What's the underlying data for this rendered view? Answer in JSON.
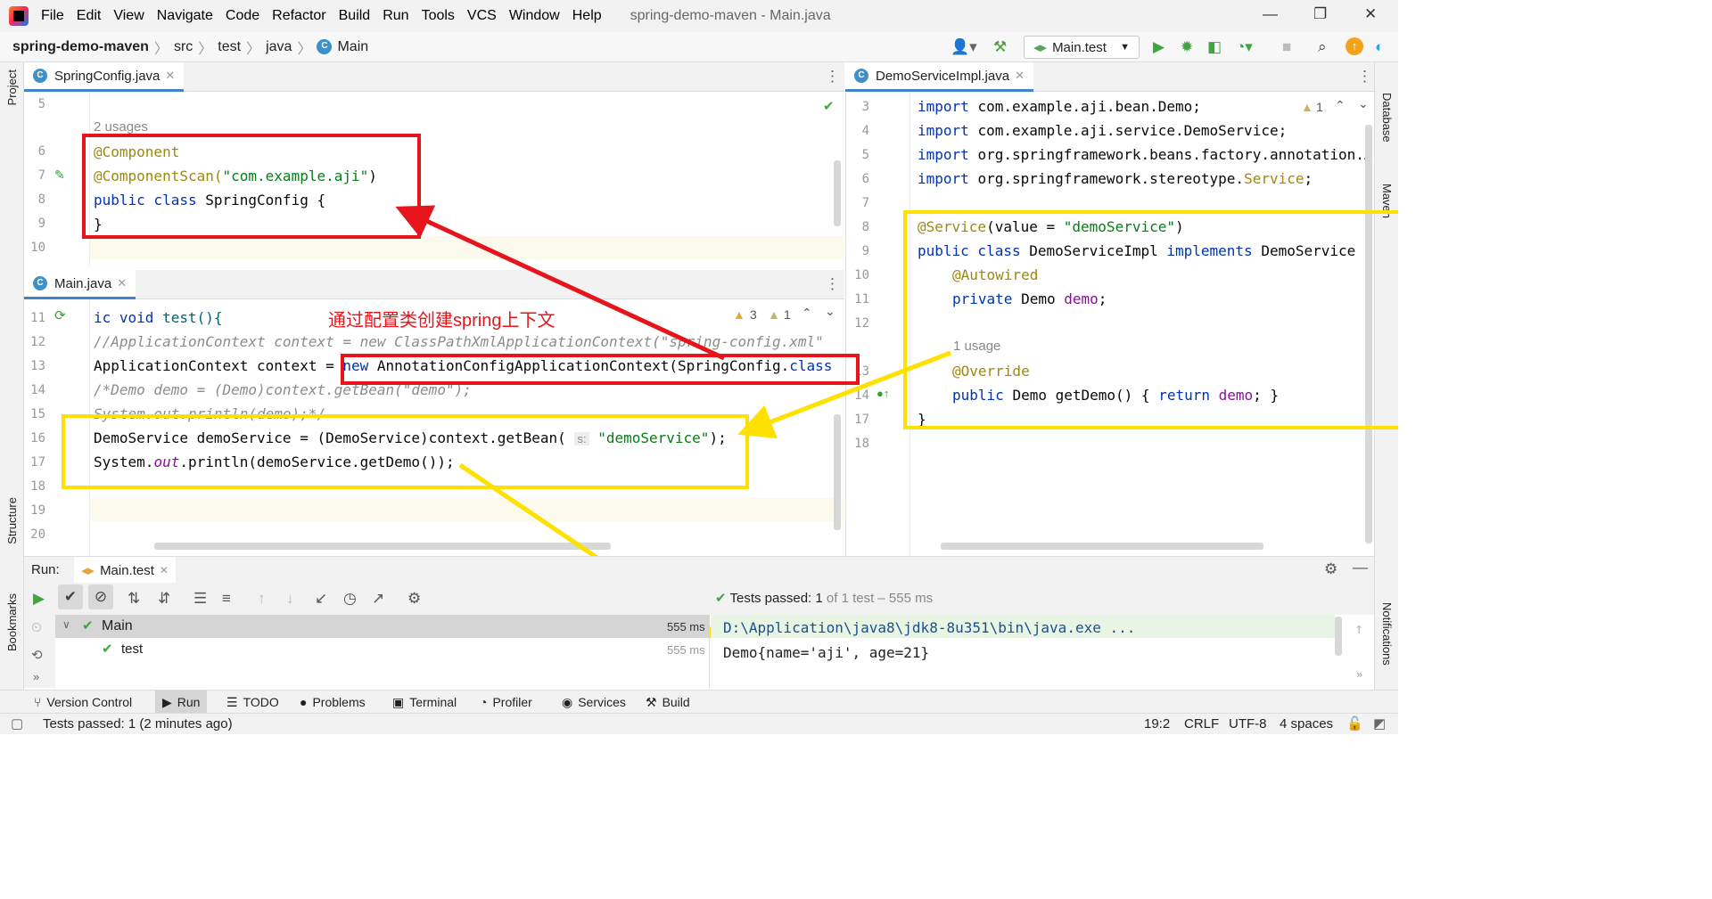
{
  "menubar": {
    "items": [
      "File",
      "Edit",
      "View",
      "Navigate",
      "Code",
      "Refactor",
      "Build",
      "Run",
      "Tools",
      "VCS",
      "Window",
      "Help"
    ],
    "window_title": "spring-demo-maven - Main.java"
  },
  "navbar": {
    "project": "spring-demo-maven",
    "crumbs": [
      "src",
      "test",
      "java"
    ],
    "file": "Main"
  },
  "toolbar": {
    "run_config": "Main.test"
  },
  "left_strip": {
    "project": "Project",
    "structure": "Structure",
    "bookmarks": "Bookmarks"
  },
  "right_strip": {
    "database": "Database",
    "maven": "Maven",
    "notifications": "Notifications"
  },
  "editor_top_left": {
    "tab": "SpringConfig.java",
    "usages": "2 usages",
    "line_numbers": [
      "5",
      "6",
      "7",
      "8",
      "9",
      "10"
    ],
    "lines": {
      "l6": "@Component",
      "l7a": "@ComponentScan(",
      "l7b": "\"com.example.aji\"",
      "l7c": ")",
      "l8a": "public class ",
      "l8b": "SpringConfig {",
      "l9": "}"
    }
  },
  "editor_bottom_left": {
    "tab": "Main.java",
    "inspections": {
      "warnings": "3",
      "weak": "1"
    },
    "line_numbers": [
      "11",
      "12",
      "13",
      "14",
      "15",
      "16",
      "17",
      "18",
      "19",
      "20"
    ],
    "lines": {
      "l11a": "ic void ",
      "l11b": "test(){",
      "l12": "//ApplicationContext context = new ClassPathXmlApplicationContext(\"spring-config.xml\"",
      "l13a": "ApplicationContext context = ",
      "l13b": "new ",
      "l13c": "AnnotationConfigApplicationContext(SpringConfig.",
      "l13d": "class",
      "l14": "/*Demo demo = (Demo)context.getBean(\"demo\");",
      "l15": "System.out.println(demo);*/",
      "l16a": "DemoService demoService = (DemoService)context.getBean( ",
      "l16hint": "s:",
      "l16b": "\"demoService\"",
      "l16c": ");",
      "l17a": "System.",
      "l17b": "out",
      "l17c": ".println(demoService.getDemo());"
    }
  },
  "editor_right": {
    "tab": "DemoServiceImpl.java",
    "inspections": {
      "weak": "1"
    },
    "line_numbers": [
      "3",
      "4",
      "5",
      "6",
      "7",
      "8",
      "9",
      "10",
      "11",
      "12",
      "13",
      "14",
      "17",
      "18"
    ],
    "lines": {
      "l3a": "import ",
      "l3b": "com.example.aji.bean.Demo;",
      "l4a": "import ",
      "l4b": "com.example.aji.service.DemoService;",
      "l5a": "import ",
      "l5b": "org.springframework.beans.factory.annotation.A",
      "l6a": "import ",
      "l6b": "org.springframework.stereotype.",
      "l6c": "Service",
      ";": ";",
      "l8a": "@Service",
      "l8b": "(value = ",
      "l8c": "\"demoService\"",
      "l8d": ")",
      "l9a": "public class ",
      "l9b": "DemoServiceImpl ",
      "l9c": "implements ",
      "l9d": "DemoService {",
      "l10": "@Autowired",
      "l11a": "private ",
      "l11b": "Demo ",
      "l11c": "demo",
      "usage": "1 usage",
      "l13": "@Override",
      "l14a": "public ",
      "l14b": "Demo getDemo() { ",
      "l14c": "return ",
      "l14d": "demo",
      "l14e": "; }",
      "l17": "}"
    }
  },
  "annotation": {
    "text": "通过配置类创建spring上下文",
    "red": "#e8141c",
    "yellow": "#ffe100"
  },
  "run": {
    "label": "Run:",
    "tab": "Main.test",
    "status_prefix": "Tests passed: ",
    "status_count": "1",
    "status_suffix": " of 1 test – 555 ms",
    "tree": [
      {
        "name": "Main",
        "time": "555 ms"
      },
      {
        "name": "test",
        "time": "555 ms"
      }
    ],
    "console": [
      "D:\\Application\\java8\\jdk8-8u351\\bin\\java.exe ...",
      "Demo{name='aji', age=21}"
    ]
  },
  "bottom_tabs": [
    "Version Control",
    "Run",
    "TODO",
    "Problems",
    "Terminal",
    "Profiler",
    "Services",
    "Build"
  ],
  "statusbar": {
    "message": "Tests passed: 1 (2 minutes ago)",
    "position": "19:2",
    "line_sep": "CRLF",
    "encoding": "UTF-8",
    "indent": "4 spaces"
  }
}
